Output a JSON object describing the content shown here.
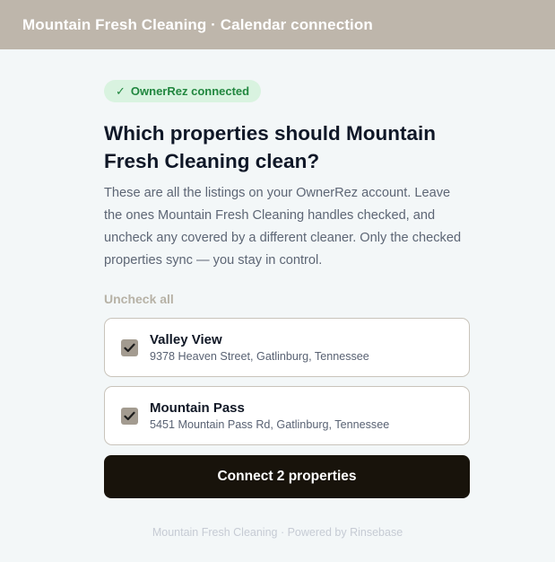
{
  "header": {
    "title": "Mountain Fresh Cleaning · Calendar connection"
  },
  "badge": {
    "check": "✓",
    "label": "OwnerRez connected"
  },
  "main": {
    "heading": "Which properties should Mountain Fresh Cleaning clean?",
    "description": "These are all the listings on your OwnerRez account. Leave the ones Mountain Fresh Cleaning handles checked, and uncheck any covered by a different cleaner. Only the checked properties sync — you stay in control.",
    "uncheck_all_label": "Uncheck all"
  },
  "properties": [
    {
      "name": "Valley View",
      "address": "9378 Heaven Street, Gatlinburg, Tennessee",
      "checked": true
    },
    {
      "name": "Mountain Pass",
      "address": "5451 Mountain Pass Rd, Gatlinburg, Tennessee",
      "checked": true
    }
  ],
  "connect_button": {
    "label": "Connect 2 properties"
  },
  "footer": {
    "text": "Mountain Fresh Cleaning · Powered by Rinsebase"
  },
  "colors": {
    "header_bg": "#beb6ab",
    "badge_bg": "#d9f3e0",
    "badge_text": "#21873f",
    "checkbox": "#a39b90",
    "button_bg": "#18130b"
  }
}
